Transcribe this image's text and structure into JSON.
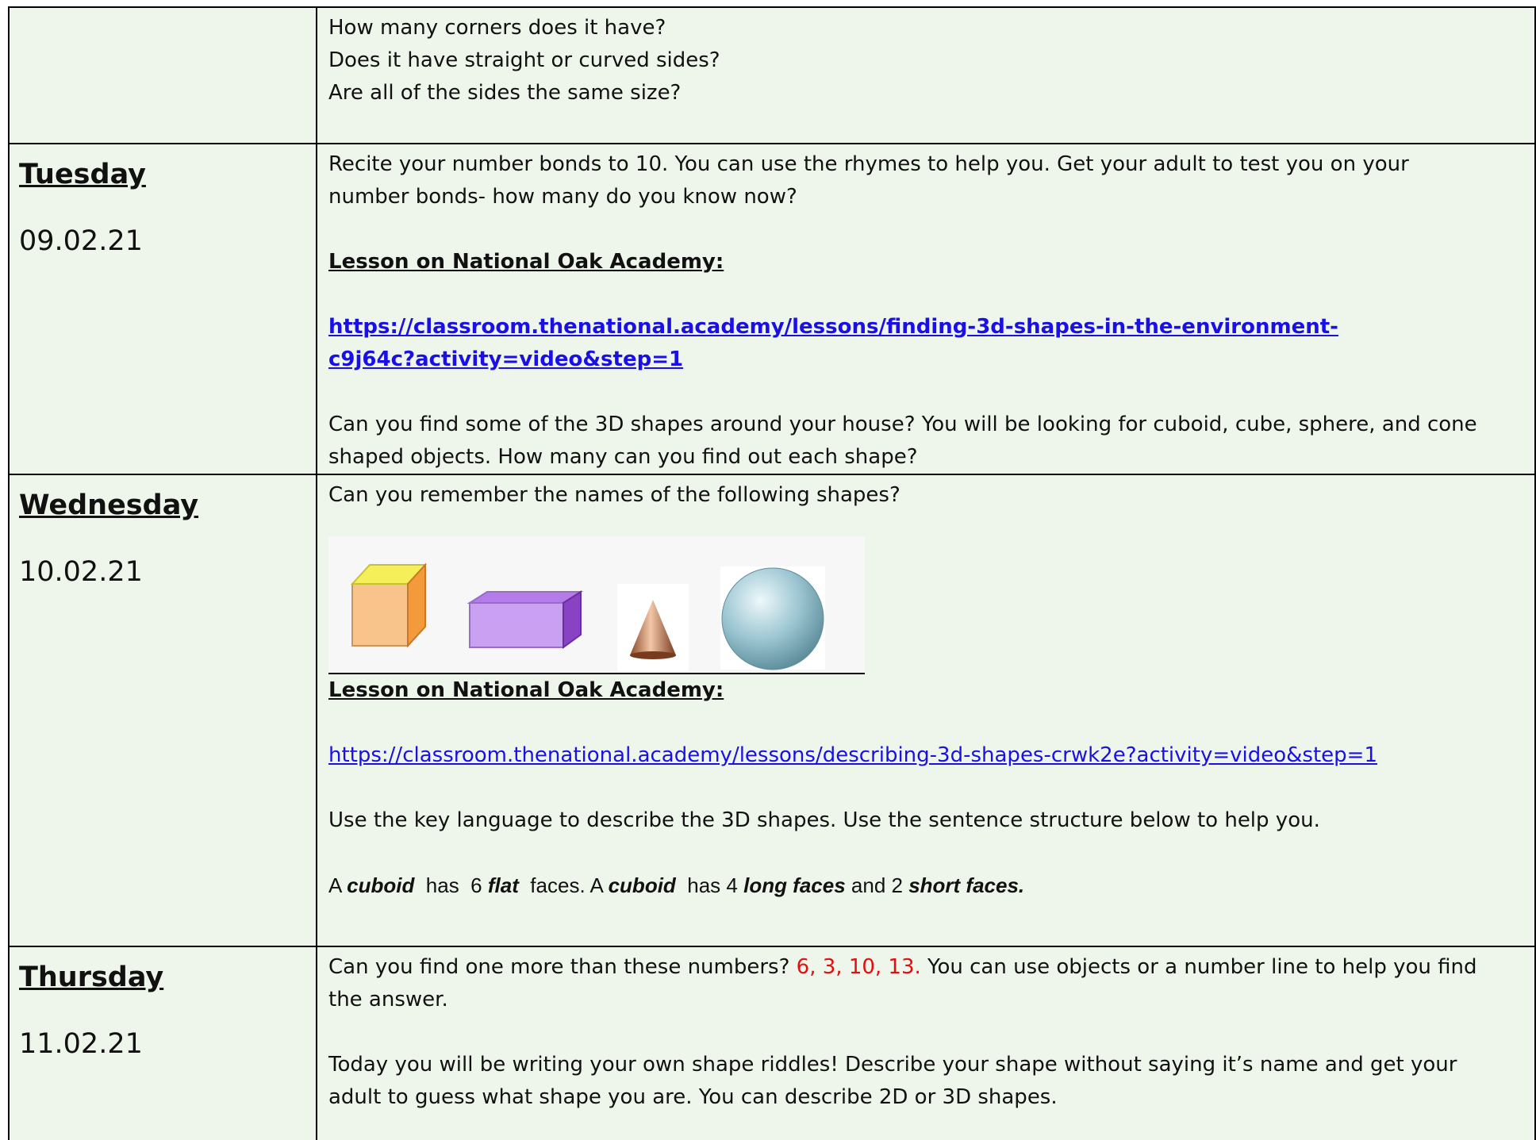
{
  "rows": [
    {
      "lines": [
        "How many corners does it have?",
        "Does it have straight or curved sides?",
        "Are all of the sides the same size?"
      ]
    },
    {
      "day": "Tuesday",
      "date": "09.02.21",
      "intro": [
        "Recite your number bonds to 10. You can use the rhymes to help you. Get your adult to test you on your",
        "number bonds-  how many do you know now?"
      ],
      "lesson_heading": "Lesson on National Oak Academy:",
      "link_lines": [
        "https://classroom.thenational.academy/lessons/finding-3d-shapes-in-the-environment-",
        "c9j64c?activity=video&step=1"
      ],
      "task": [
        "Can you find some of the 3D shapes around your house? You will be looking for cuboid, cube, sphere, and cone",
        "shaped objects. How many can you find out each shape?"
      ]
    },
    {
      "day": "Wednesday",
      "date": "10.02.21",
      "intro": "Can you remember the names of the following shapes?",
      "shapes": [
        "cube-icon",
        "cuboid-icon",
        "cone-icon",
        "sphere-icon"
      ],
      "lesson_heading": "Lesson on National Oak Academy:",
      "link": "https://classroom.thenational.academy/lessons/describing-3d-shapes-crwk2e?activity=video&step=1",
      "instruction": "Use the key language to describe the 3D shapes. Use the sentence structure below to help you.",
      "sentence": {
        "p1": "A ",
        "w1": "cuboid",
        "p2": "  has  6 ",
        "w2": "flat",
        "p3": "  faces. A ",
        "w3": "cuboid",
        "p4": "  has 4 ",
        "w4": "long faces",
        "p5": " and 2 ",
        "w5": "short faces."
      }
    },
    {
      "day": "Thursday",
      "date": "11.02.21",
      "q_prefix": "Can you find one more than these numbers? ",
      "q_numbers": "6, 3, 10, 13.",
      "q_suffix": " You can use objects or a number line to help you find",
      "q_line2": "the answer.",
      "riddle": [
        "Today you will be writing your own shape riddles! Describe your shape without saying it’s name and get your",
        "adult to guess what shape you are. You can describe 2D or 3D shapes."
      ]
    }
  ],
  "colors": {
    "background": "#eef5ea",
    "link": "#1a10e6",
    "highlight": "#e01010"
  }
}
